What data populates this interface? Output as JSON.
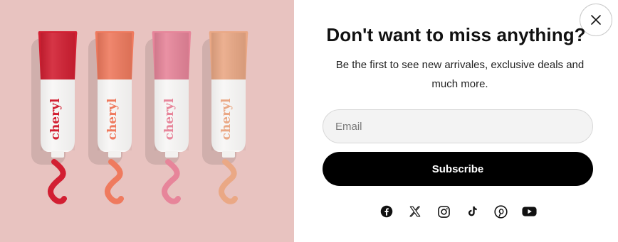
{
  "popup": {
    "headline": "Don't want to miss anything?",
    "subtext": "Be the first to see new arrivales, exclusive deals and much more.",
    "email_placeholder": "Email",
    "email_value": "",
    "subscribe_label": "Subscribe"
  },
  "product_image": {
    "brand_text": "cheryl",
    "tube_colors": [
      "#d21f32",
      "#ef7a5e",
      "#e7859a",
      "#eaa885"
    ],
    "background": "#e8c3c0"
  },
  "social_links": [
    {
      "network": "facebook",
      "icon": "facebook-icon"
    },
    {
      "network": "x",
      "icon": "x-icon"
    },
    {
      "network": "instagram",
      "icon": "instagram-icon"
    },
    {
      "network": "tiktok",
      "icon": "tiktok-icon"
    },
    {
      "network": "pinterest",
      "icon": "pinterest-icon"
    },
    {
      "network": "youtube",
      "icon": "youtube-icon"
    }
  ],
  "colors": {
    "button_bg": "#000000",
    "button_text": "#ffffff",
    "input_bg": "#f3f3f3"
  }
}
